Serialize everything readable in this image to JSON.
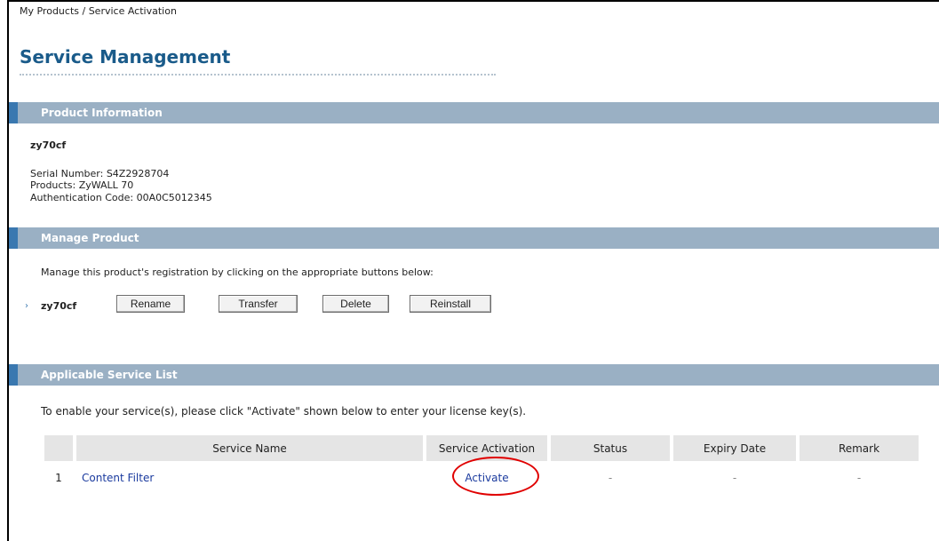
{
  "breadcrumb": "My Products / Service Activation",
  "page_title": "Service Management",
  "product_info": {
    "header": "Product Information",
    "name": "zy70cf",
    "serial": "Serial Number: S4Z2928704",
    "products": "Products: ZyWALL 70",
    "auth_code": "Authentication Code: 00A0C5012345"
  },
  "manage": {
    "header": "Manage Product",
    "instructions": "Manage this product's registration by clicking on the appropriate buttons below:",
    "product_name": "zy70cf",
    "buttons": {
      "rename": "Rename",
      "transfer": "Transfer",
      "delete": "Delete",
      "reinstall": "Reinstall"
    }
  },
  "services": {
    "header": "Applicable Service List",
    "instructions": "To enable your service(s), please click \"Activate\" shown below to enter your license key(s).",
    "columns": [
      "",
      "Service Name",
      "Service Activation",
      "Status",
      "Expiry Date",
      "Remark"
    ],
    "rows": [
      {
        "index": "1",
        "name": "Content Filter",
        "activation": "Activate",
        "status": "-",
        "expiry": "-",
        "remark": "-"
      }
    ]
  },
  "colors": {
    "section_bar": "#9ab0c4",
    "section_accent": "#3a78b0",
    "title": "#1a5b8a",
    "link": "#1a3a9e",
    "highlight_circle": "#e00000"
  }
}
